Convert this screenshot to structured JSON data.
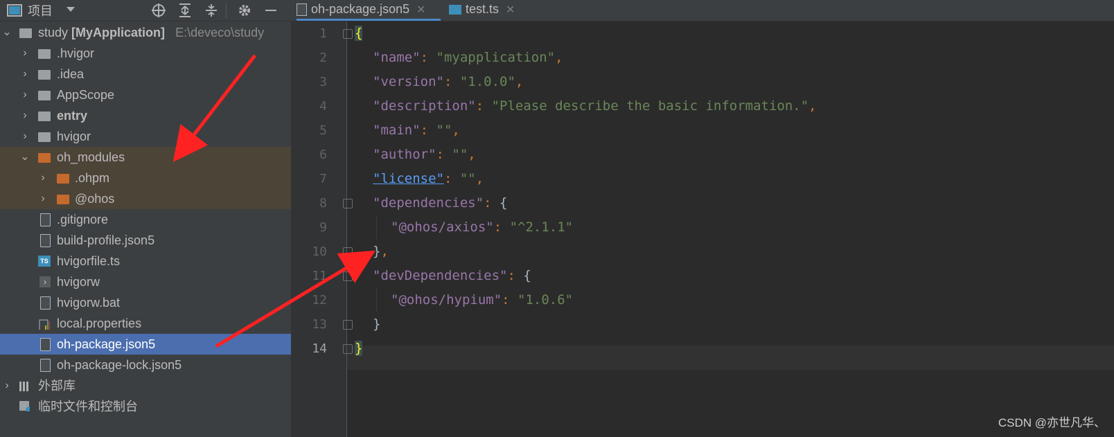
{
  "panel": {
    "title": "项目",
    "icons": [
      "window-icon",
      "dropdown-icon",
      "locate-icon",
      "expand-all-icon",
      "collapse-all-icon",
      "settings-icon",
      "minimize-icon"
    ]
  },
  "tree": {
    "root_name": "study",
    "root_module": "[MyApplication]",
    "root_path": "E:\\deveco\\study",
    "items": [
      {
        "label": "study [MyApplication]"
      },
      {
        "label": ".hvigor"
      },
      {
        "label": ".idea"
      },
      {
        "label": "AppScope"
      },
      {
        "label": "entry"
      },
      {
        "label": "hvigor"
      },
      {
        "label": "oh_modules"
      },
      {
        "label": ".ohpm"
      },
      {
        "label": "@ohos"
      },
      {
        "label": ".gitignore"
      },
      {
        "label": "build-profile.json5"
      },
      {
        "label": "hvigorfile.ts"
      },
      {
        "label": "hvigorw"
      },
      {
        "label": "hvigorw.bat"
      },
      {
        "label": "local.properties"
      },
      {
        "label": "oh-package.json5"
      },
      {
        "label": "oh-package-lock.json5"
      },
      {
        "label": "外部库"
      },
      {
        "label": "临时文件和控制台"
      }
    ]
  },
  "tabs": [
    {
      "label": "oh-package.json5",
      "active": true
    },
    {
      "label": "test.ts",
      "active": false
    }
  ],
  "editor": {
    "line_numbers": [
      "1",
      "2",
      "3",
      "4",
      "5",
      "6",
      "7",
      "8",
      "9",
      "10",
      "11",
      "12",
      "13",
      "14"
    ],
    "current_line": 14,
    "tokens": {
      "open": "{",
      "close": "}",
      "name_key": "\"name\"",
      "name_val": "\"myapplication\"",
      "version_key": "\"version\"",
      "version_val": "\"1.0.0\"",
      "description_key": "\"description\"",
      "description_val": "\"Please describe the basic information.\"",
      "main_key": "\"main\"",
      "main_val": "\"\"",
      "author_key": "\"author\"",
      "author_val": "\"\"",
      "license_key": "\"license\"",
      "license_val": "\"\"",
      "dependencies_key": "\"dependencies\"",
      "axios_key": "\"@ohos/axios\"",
      "axios_val": "\"^2.1.1\"",
      "devdeps_key": "\"devDependencies\"",
      "hypium_key": "\"@ohos/hypium\"",
      "hypium_val": "\"1.0.6\"",
      "colon": ": ",
      "comma": ",",
      "obj_open": "{",
      "obj_close": "}"
    }
  },
  "watermark": "CSDN @亦世凡华、",
  "colors": {
    "sidebar_bg": "#3c3f41",
    "editor_bg": "#2b2b2b",
    "selection": "#4b6eaf",
    "folder_highlight": "#4d4438",
    "arrow": "#ff2222",
    "string": "#6a8759",
    "key": "#9876aa"
  }
}
